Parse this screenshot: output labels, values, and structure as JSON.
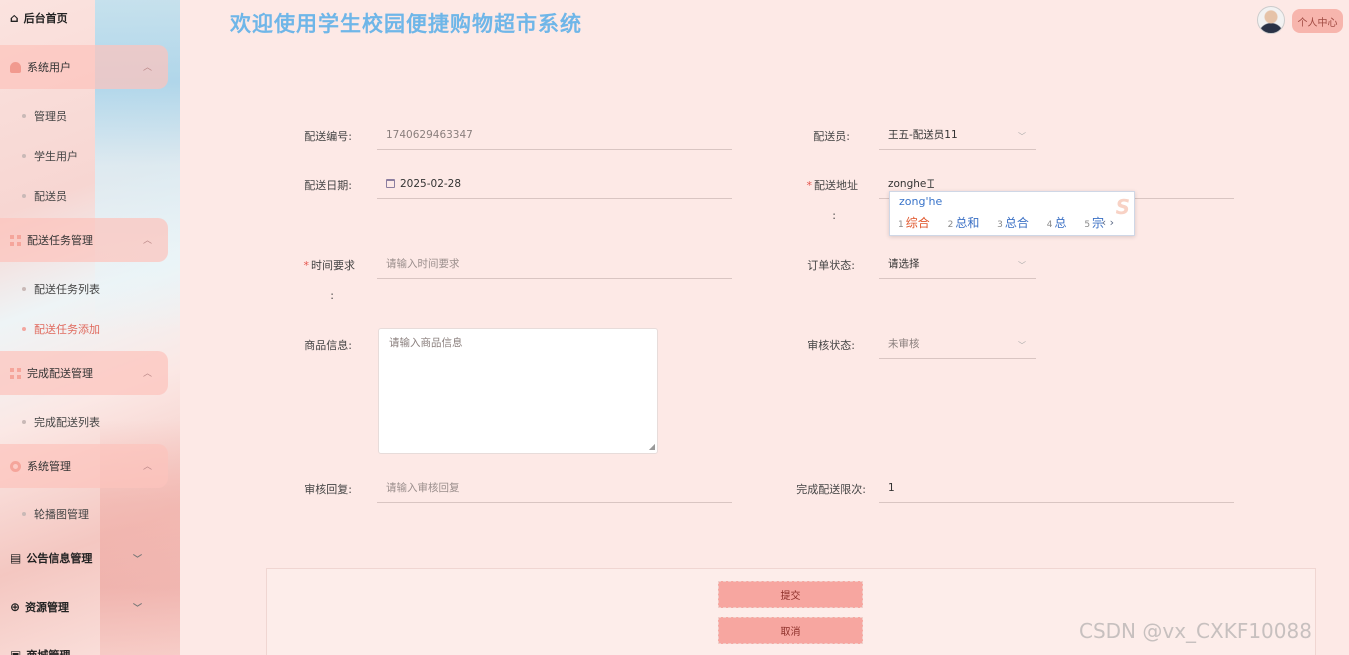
{
  "header": {
    "title": "欢迎使用学生校园便捷购物超市系统",
    "user_button": "个人中心"
  },
  "sidebar": {
    "home": "后台首页",
    "groups": [
      {
        "label": "系统用户",
        "items": [
          "管理员",
          "学生用户",
          "配送员"
        ]
      },
      {
        "label": "配送任务管理",
        "items": [
          "配送任务列表",
          "配送任务添加"
        ]
      },
      {
        "label": "完成配送管理",
        "items": [
          "完成配送列表"
        ]
      },
      {
        "label": "系统管理",
        "items": [
          "轮播图管理"
        ]
      }
    ],
    "tops": [
      "公告信息管理",
      "资源管理",
      "商城管理"
    ],
    "active_item": "配送任务添加"
  },
  "form": {
    "delivery_no": {
      "label": "配送编号:",
      "value": "1740629463347"
    },
    "courier": {
      "label": "配送员:",
      "value": "王五-配送员11"
    },
    "delivery_date": {
      "label": "配送日期:",
      "value": "2025-02-28"
    },
    "address": {
      "label_1": "配送地址",
      "label_2": ":",
      "value": "zonghe"
    },
    "time_req": {
      "label_1": "时间要求",
      "label_2": ":",
      "placeholder": "请输入时间要求"
    },
    "order_status": {
      "label": "订单状态:",
      "placeholder": "请选择"
    },
    "goods_info": {
      "label": "商品信息:",
      "placeholder": "请输入商品信息"
    },
    "review_status": {
      "label": "审核状态:",
      "value": "未审核"
    },
    "review_reply": {
      "label": "审核回复:",
      "placeholder": "请输入审核回复"
    },
    "finish_limit": {
      "label": "完成配送限次:",
      "value": "1"
    }
  },
  "ime": {
    "pinyin": "zong'he",
    "candidates": [
      {
        "n": "1",
        "text": "综合"
      },
      {
        "n": "2",
        "text": "总和"
      },
      {
        "n": "3",
        "text": "总合"
      },
      {
        "n": "4",
        "text": "总"
      },
      {
        "n": "5",
        "text": "宗"
      }
    ],
    "arrows": "‹ ›",
    "logo": "S"
  },
  "buttons": {
    "submit": "提交",
    "cancel": "取消"
  },
  "watermark": "CSDN @vx_CXKF10088",
  "colors": {
    "accent": "#f7a6a0",
    "title": "#6fb6e8",
    "active": "#e06a5e"
  }
}
